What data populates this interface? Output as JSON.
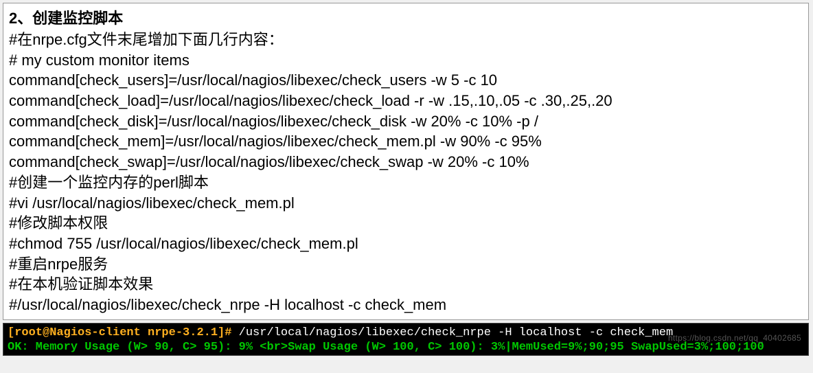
{
  "doc": {
    "heading": "2、创建监控脚本",
    "lines": [
      "#在nrpe.cfg文件末尾增加下面几行内容：",
      "# my custom monitor items",
      "command[check_users]=/usr/local/nagios/libexec/check_users -w 5 -c 10",
      "command[check_load]=/usr/local/nagios/libexec/check_load -r -w .15,.10,.05 -c .30,.25,.20",
      "command[check_disk]=/usr/local/nagios/libexec/check_disk -w 20% -c 10% -p /",
      "command[check_mem]=/usr/local/nagios/libexec/check_mem.pl -w 90% -c 95%",
      "command[check_swap]=/usr/local/nagios/libexec/check_swap -w 20% -c 10%",
      "#创建一个监控内存的perl脚本",
      "#vi /usr/local/nagios/libexec/check_mem.pl",
      "#修改脚本权限",
      "#chmod 755 /usr/local/nagios/libexec/check_mem.pl",
      "#重启nrpe服务",
      "#在本机验证脚本效果",
      "#/usr/local/nagios/libexec/check_nrpe -H localhost -c check_mem"
    ]
  },
  "terminal": {
    "prompt": "[root@Nagios-client nrpe-3.2.1]#",
    "command": " /usr/local/nagios/libexec/check_nrpe -H localhost -c check_mem",
    "output": "OK: Memory Usage (W> 90, C> 95): 9% <br>Swap Usage (W> 100, C> 100): 3%|MemUsed=9%;90;95 SwapUsed=3%;100;100",
    "watermark": "https://blog.csdn.net/qq_40402685"
  }
}
